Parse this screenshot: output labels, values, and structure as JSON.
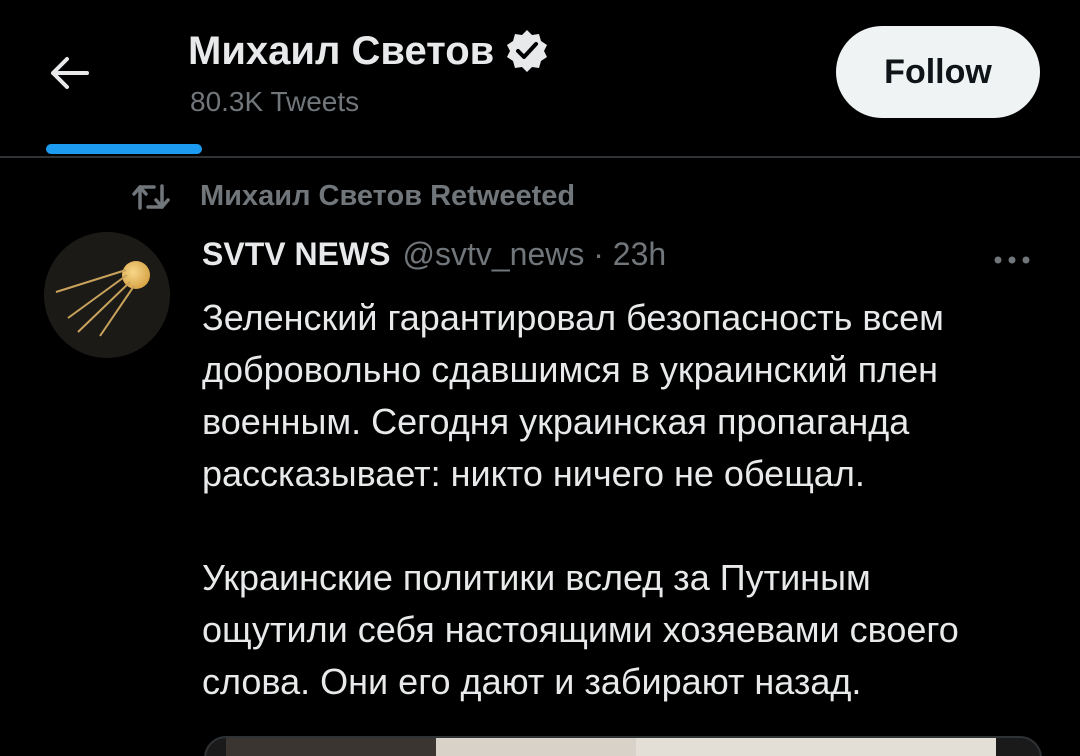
{
  "header": {
    "back_icon": "arrow-left-icon",
    "profile_name": "Михаил Светов",
    "verified_icon": "verified-badge-icon",
    "tweet_count": "80.3K Tweets",
    "follow_label": "Follow"
  },
  "retweet": {
    "icon": "retweet-icon",
    "label": "Михаил Светов Retweeted"
  },
  "tweet": {
    "avatar_icon": "sputnik-icon",
    "author_name": "SVTV NEWS",
    "author_meta": "@svtv_news · 23h",
    "more_icon": "more-dots-icon",
    "paragraph1": [
      "Зеленский гарантировал безопасность всем",
      "добровольно сдавшимся в украинский плен",
      "военным. Сегодня украинская пропаганда",
      "рассказывает: никто ничего не обещал."
    ],
    "paragraph2": [
      "Украинские политики вслед за Путиным",
      "ощутили себя настоящими хозяевами своего",
      "слова. Они его дают и забирают назад."
    ]
  },
  "colors": {
    "background": "#000000",
    "text_primary": "#e7e9ea",
    "text_secondary": "#71767b",
    "accent": "#1d9bf0",
    "follow_bg": "#eff3f4"
  }
}
